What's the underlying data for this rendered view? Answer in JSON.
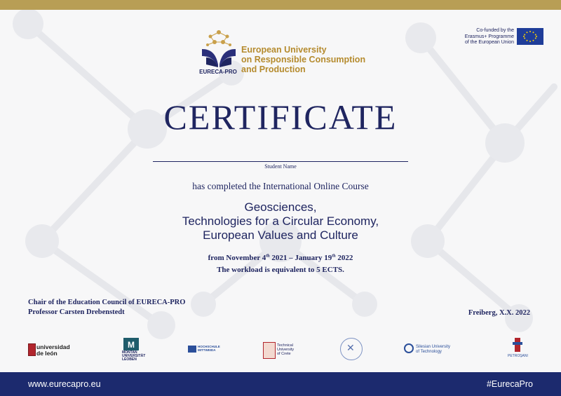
{
  "header": {
    "logo_caption": "EURECA-PRO",
    "university_name": [
      "European University",
      "on Responsible Consumption",
      "and Production"
    ],
    "erasmus_lines": [
      "Co-funded by the",
      "Erasmus+ Programme",
      "of the European Union"
    ]
  },
  "certificate": {
    "title": "CERTIFICATE",
    "student_name_label": "Student Name",
    "completed_text": "has completed the International Online Course",
    "course_lines": [
      "Geosciences,",
      "Technologies for a Circular Economy,",
      "European Values and Culture"
    ],
    "date_from_prefix": "from November 4",
    "date_from_sup": "th",
    "date_from_year": " 2021 – January 19",
    "date_to_sup": "th",
    "date_to_year": " 2022",
    "workload": "The workload is equivalent to 5 ECTS."
  },
  "signatory": {
    "role": "Chair of the Education Council of  EURECA-PRO",
    "name": "Professor Carsten Drebenstedt"
  },
  "place_date": "Freiberg, X.X. 2022",
  "partners": {
    "leon": [
      "universidad",
      "de león"
    ],
    "montan": {
      "mark": "M",
      "lines": [
        "MONTAN",
        "UNIVERSITÄT",
        "LEOBEN"
      ]
    },
    "mittweida": [
      "HOCHSCHULE",
      "MITTWEIDA"
    ],
    "crete": [
      "Technical",
      "University",
      "of Crete"
    ],
    "freiberg": "FREIBERG",
    "silesian": [
      "Silesian University",
      "of Technology"
    ],
    "petrosani": "PETROŞANI"
  },
  "footer": {
    "website": "www.eurecapro.eu",
    "hashtag": "#EurecaPro"
  },
  "colors": {
    "navy": "#1f2560",
    "gold": "#b89e55",
    "footer_bg": "#1c2a6e"
  }
}
